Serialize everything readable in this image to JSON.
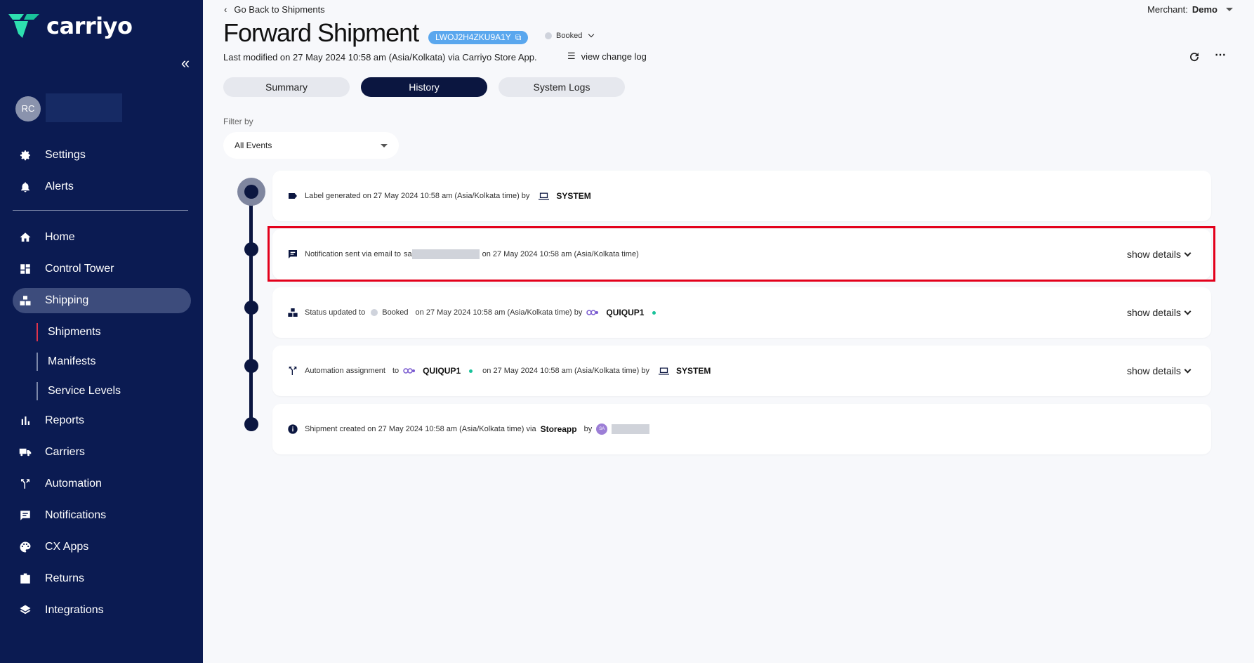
{
  "sidebar": {
    "brand": "carriyo",
    "user_initials": "RC",
    "top_items": [
      {
        "label": "Settings",
        "icon": "gear-icon"
      },
      {
        "label": "Alerts",
        "icon": "bell-icon"
      }
    ],
    "items": [
      {
        "label": "Home",
        "icon": "home-icon"
      },
      {
        "label": "Control Tower",
        "icon": "dashboard-icon"
      },
      {
        "label": "Shipping",
        "icon": "boxes-icon",
        "active": true
      },
      {
        "label": "Reports",
        "icon": "bar-chart-icon"
      },
      {
        "label": "Carriers",
        "icon": "truck-icon"
      },
      {
        "label": "Automation",
        "icon": "fork-icon"
      },
      {
        "label": "Notifications",
        "icon": "message-icon"
      },
      {
        "label": "CX Apps",
        "icon": "palette-icon"
      },
      {
        "label": "Returns",
        "icon": "return-box-icon"
      },
      {
        "label": "Integrations",
        "icon": "layers-icon"
      }
    ],
    "sub_items": [
      {
        "label": "Shipments",
        "active": true
      },
      {
        "label": "Manifests"
      },
      {
        "label": "Service Levels"
      }
    ]
  },
  "header": {
    "back_label": "Go Back to Shipments",
    "merchant_label": "Merchant:",
    "merchant_value": "Demo",
    "title": "Forward Shipment",
    "tracking_id": "LWOJ2H4ZKU9A1Y",
    "status": "Booked",
    "last_modified": "Last modified on 27 May 2024 10:58 am (Asia/Kolkata) via Carriyo Store App.",
    "change_log_label": "view change log"
  },
  "tabs": [
    {
      "label": "Summary",
      "active": false
    },
    {
      "label": "History",
      "active": true
    },
    {
      "label": "System Logs",
      "active": false
    }
  ],
  "filter": {
    "label": "Filter by",
    "value": "All Events"
  },
  "events": [
    {
      "icon": "label-tag-icon",
      "text": "Label generated on 27 May 2024 10:58 am (Asia/Kolkata time) by",
      "actor": "SYSTEM"
    },
    {
      "icon": "chat-message-icon",
      "text_prefix": "Notification sent via email to",
      "email_visible": "sa",
      "text_suffix": "on 27 May 2024 10:58 am (Asia/Kolkata time)",
      "show_details": "show details"
    },
    {
      "icon": "boxes-icon",
      "text_prefix": "Status updated to",
      "status": "Booked",
      "text_mid": "on  27 May 2024 10:58 am (Asia/Kolkata time) by",
      "carrier": "QUIQUP1",
      "show_details": "show details"
    },
    {
      "icon": "fork-icon",
      "text_prefix": "Automation assignment",
      "to": "to",
      "carrier": "QUIQUP1",
      "text_mid": "on  27 May 2024 10:58 am (Asia/Kolkata time) by",
      "actor": "SYSTEM",
      "show_details": "show details"
    },
    {
      "icon": "info-icon",
      "text_prefix": "Shipment created on 27 May 2024 10:58 am (Asia/Kolkata time) via",
      "source": "Storeapp",
      "by": "by",
      "user_initials": "SA"
    }
  ],
  "colors": {
    "sidebar_bg": "#0b1b52",
    "accent_navy": "#0b1640",
    "badge_blue": "#5aa7ee",
    "highlight_red": "#e3001b",
    "status_green": "#19c29a"
  }
}
